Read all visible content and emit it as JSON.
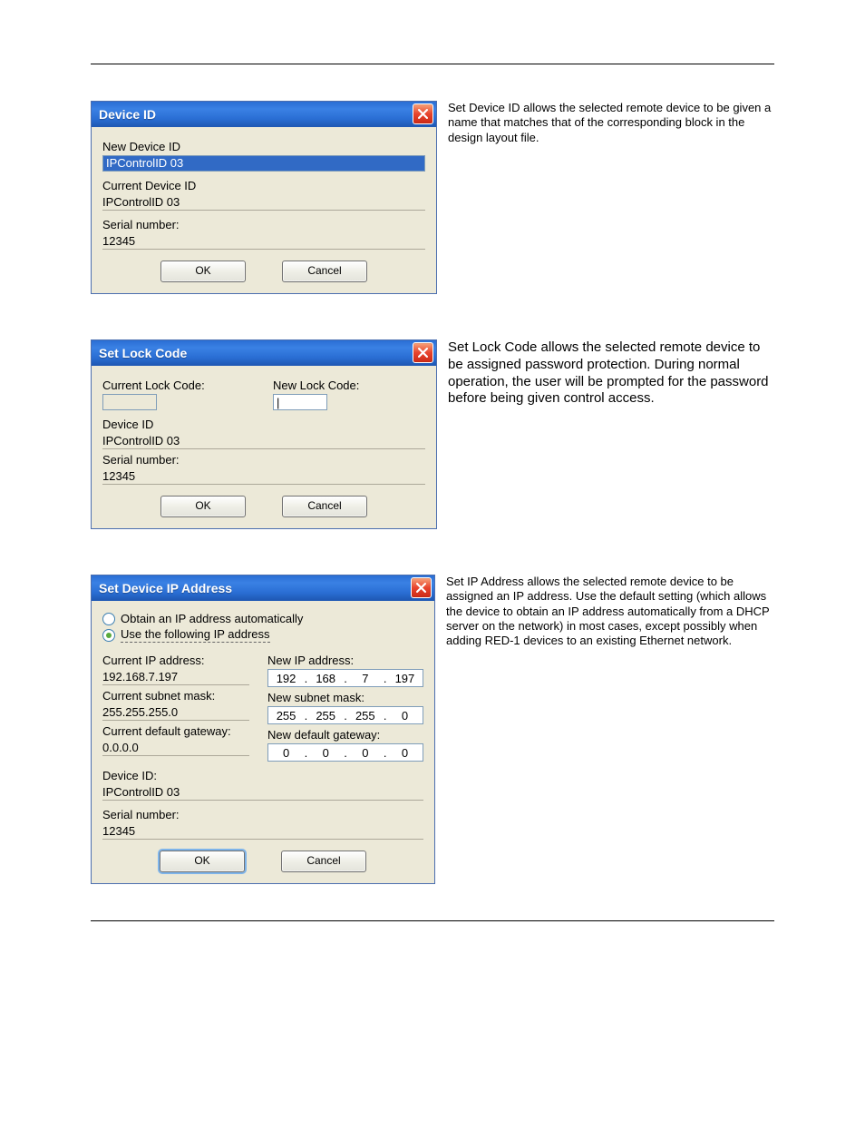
{
  "dialogs": {
    "device_id": {
      "title": "Device ID",
      "new_device_id_label": "New Device ID",
      "new_device_id_value": "IPControlID 03",
      "current_device_id_label": "Current Device ID",
      "current_device_id_value": "IPControlID 03",
      "serial_number_label": "Serial number:",
      "serial_number_value": "12345",
      "ok_label": "OK",
      "cancel_label": "Cancel"
    },
    "set_lock_code": {
      "title": "Set Lock Code",
      "current_lock_code_label": "Current Lock Code:",
      "current_lock_code_value": "",
      "new_lock_code_label": "New Lock Code:",
      "new_lock_code_value": "",
      "device_id_label": "Device ID",
      "device_id_value": "IPControlID 03",
      "serial_number_label": "Serial number:",
      "serial_number_value": "12345",
      "ok_label": "OK",
      "cancel_label": "Cancel"
    },
    "set_ip": {
      "title": "Set Device IP Address",
      "radio_auto": "Obtain an IP address automatically",
      "radio_manual": "Use the following IP address",
      "radio_selected": "manual",
      "current_ip_label": "Current IP address:",
      "current_ip_value": "192.168.7.197",
      "new_ip_label": "New IP address:",
      "new_ip_value": [
        "192",
        "168",
        "7",
        "197"
      ],
      "current_subnet_label": "Current subnet mask:",
      "current_subnet_value": "255.255.255.0",
      "new_subnet_label": "New subnet mask:",
      "new_subnet_value": [
        "255",
        "255",
        "255",
        "0"
      ],
      "current_gateway_label": "Current default gateway:",
      "current_gateway_value": "0.0.0.0",
      "new_gateway_label": "New default gateway:",
      "new_gateway_value": [
        "0",
        "0",
        "0",
        "0"
      ],
      "device_id_label": "Device ID:",
      "device_id_value": "IPControlID 03",
      "serial_number_label": "Serial number:",
      "serial_number_value": "12345",
      "ok_label": "OK",
      "cancel_label": "Cancel"
    }
  },
  "descriptions": {
    "device_id": "Set Device ID allows the selected remote device to be given a name that matches that of the corresponding block in the design layout file.",
    "set_lock_code": "Set Lock Code allows the selected remote device to be assigned password protection. During normal operation, the user will be prompted for the password before being given control access.",
    "set_ip": "Set IP Address allows the selected remote device to be assigned an IP address. Use the default setting (which allows the device to obtain an IP address automatically from a DHCP server on the network) in most cases, except possibly when adding RED-1 devices to an existing Ethernet network."
  }
}
